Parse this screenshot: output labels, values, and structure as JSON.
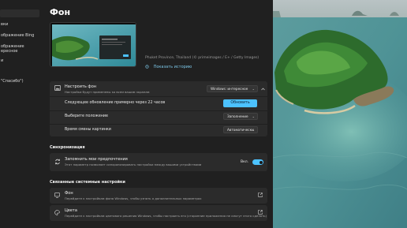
{
  "sidebar": {
    "items": [
      {
        "label": ""
      },
      {
        "label": "вки"
      },
      {
        "label": "ображение Bing"
      },
      {
        "label": "ображение"
      },
      {
        "label": "ересное"
      },
      {
        "label": "и"
      },
      {
        "label": "\"Спасибо\")"
      }
    ]
  },
  "page": {
    "title": "Фон"
  },
  "preview": {
    "credit": "Phuket Province, Thailand (© primeimages / E+ / Getty Images)",
    "history_link": "Показать историю"
  },
  "personalize": {
    "title": "Настроить фон",
    "subtitle": "Настройки будут применены ко всем вашим экранам",
    "selected": "Windows: интересное",
    "next_update_label": "Следующее обновление примерно через 22 часов",
    "refresh_button": "Обновить",
    "position_label": "Выберите положение",
    "position_value": "Заполнение",
    "interval_label": "Время смены картинки",
    "interval_value": "Автоматически"
  },
  "sync": {
    "section_title": "Синхронизация",
    "title": "Запомнить мои предпочтения",
    "subtitle": "Этот параметр позволяет синхронизировать настройки между вашими устройствами",
    "toggle_state": "Вкл."
  },
  "related": {
    "section_title": "Связанные системные настройки",
    "items": [
      {
        "title": "Фон",
        "subtitle": "Перейдите к настройкам фона Windows, чтобы узнать о дополнительных параметрах"
      },
      {
        "title": "Цвета",
        "subtitle": "Перейдите к настройкам цветового решения Windows, чтобы настроить его (сторонние приложения не смогут этого сделать)"
      }
    ]
  },
  "colors": {
    "accent": "#4cc2ff",
    "background": "#202020",
    "card": "#2b2b2b"
  }
}
